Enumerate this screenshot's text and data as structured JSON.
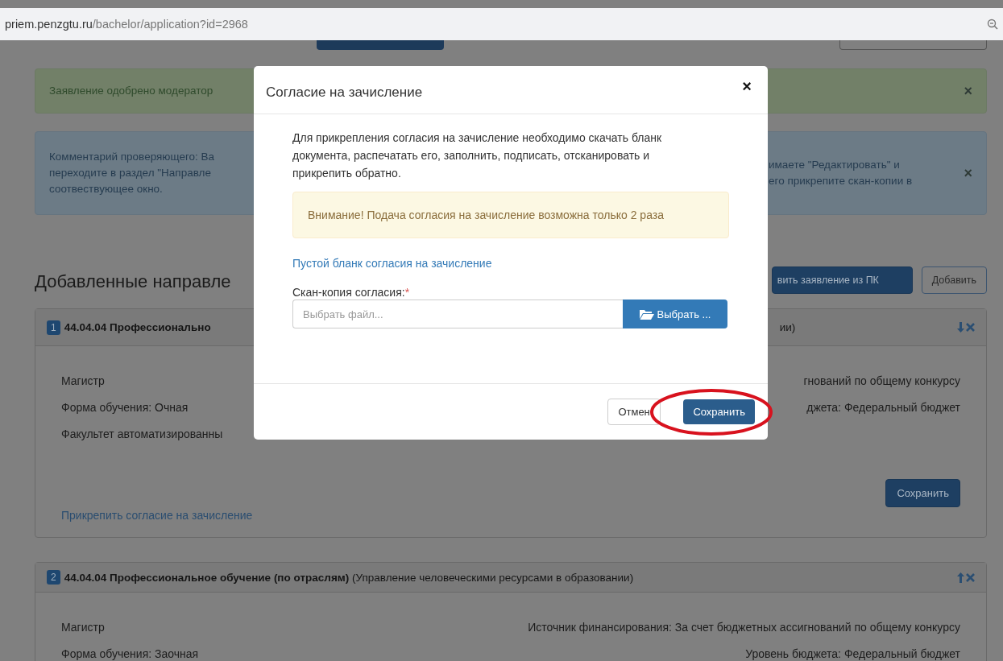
{
  "address_bar": {
    "host": "priem.penzgtu.ru",
    "path": "/bachelor/application?id=2968"
  },
  "alerts": [
    {
      "kind": "success",
      "left": [
        "Заявление одобрено модератор"
      ],
      "close": "×"
    },
    {
      "kind": "info",
      "left": [
        "Комментарий проверяющего: Ва",
        "переходите в раздел \"Направле",
        "соотвествующее окно."
      ],
      "right": [
        "имаете \"Редактировать\" и",
        "его прикрепите скан-копии в"
      ],
      "close": "×"
    }
  ],
  "section": {
    "heading": "Добавленные направле",
    "buttons": [
      {
        "label": "вить заявление из ПК",
        "kind": "primary"
      },
      {
        "label": "Добавить",
        "kind": "default"
      }
    ]
  },
  "directions": [
    {
      "number": "1",
      "title": "44.04.04 Профессионально",
      "title_right": "ии)",
      "move_up": false,
      "rows": [
        {
          "left": "Магистр",
          "right": "гнований по общему конкурсу"
        },
        {
          "left": "Форма обучения: Очная",
          "right": "джета: Федеральный бюджет"
        },
        {
          "left": "Факультет автоматизированны"
        }
      ],
      "save_button": "Сохранить",
      "attach_link": "Прикрепить согласие на зачисление"
    },
    {
      "number": "2",
      "title": "**44.04.04 Профессиональное обучение (по отраслям)** (Управление человеческими ресурсами в образовании)",
      "move_up": true,
      "rows": [
        {
          "left": "Магистр",
          "right": "Источник финансирования: За счет бюджетных ассигнований по общему конкурсу"
        },
        {
          "left": "Форма обучения: Заочная",
          "right": "Уровень бюджета: Федеральный бюджет"
        }
      ]
    }
  ],
  "modal": {
    "title": "Согласие на зачисление",
    "close": "×",
    "text": "Для прикрепления согласия на зачисление необходимо скачать бланк документа, распечатать его, заполнить, подписать, отсканировать и прикрепить обратно.",
    "warning": "Внимание! Подача согласия на зачисление возможна только 2 раза",
    "template_link": "Пустой бланк согласия на зачисление",
    "file_label": "Скан-копия согласия:",
    "required_mark": "*",
    "file_placeholder": "Выбрать файл...",
    "browse_button": "Выбрать ...",
    "cancel_button": "Отмен",
    "save_button": "Сохранить",
    "save_highlighted": true
  }
}
